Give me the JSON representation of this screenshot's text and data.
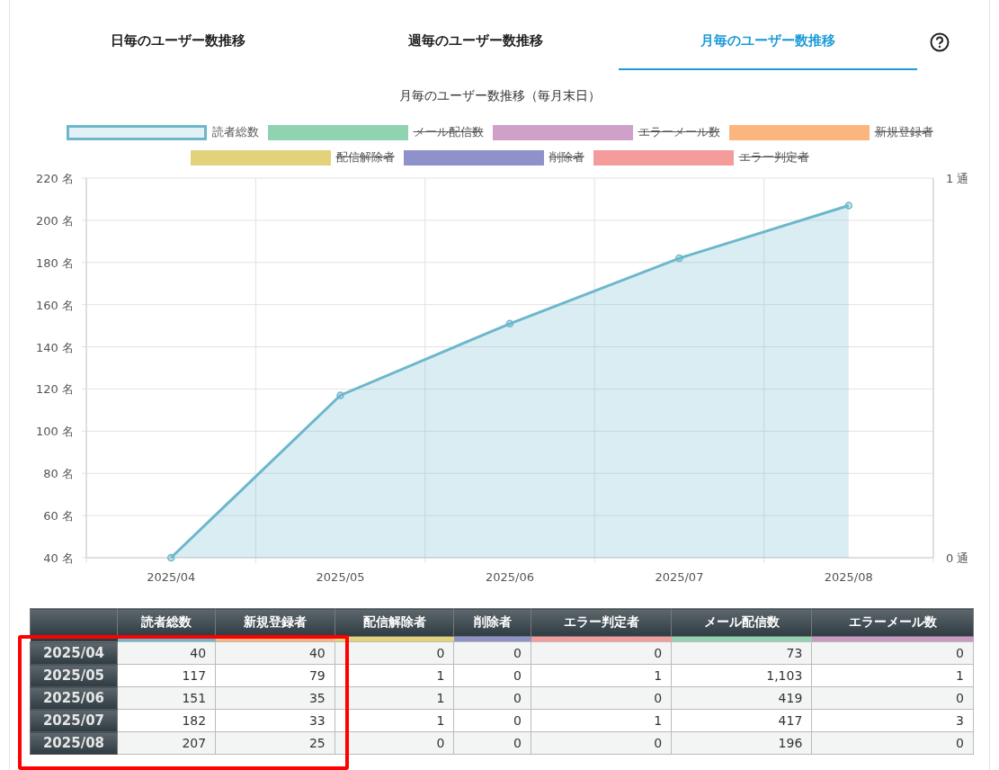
{
  "tabs": [
    {
      "label": "日毎のユーザー数推移",
      "selected": false
    },
    {
      "label": "週毎のユーザー数推移",
      "selected": false
    },
    {
      "label": "月毎のユーザー数推移",
      "selected": true
    }
  ],
  "chart": {
    "title": "月毎のユーザー数推移（毎月末日）",
    "legend": [
      {
        "label": "読者総数",
        "color": "#6cb7cb",
        "hidden": false
      },
      {
        "label": "メール配信数",
        "color": "#8fd3b0",
        "hidden": true
      },
      {
        "label": "エラーメール数",
        "color": "#cfa0c8",
        "hidden": true
      },
      {
        "label": "新規登録者",
        "color": "#fcb57e",
        "hidden": true
      },
      {
        "label": "配信解除者",
        "color": "#e2d37a",
        "hidden": true
      },
      {
        "label": "削除者",
        "color": "#8f92c9",
        "hidden": true
      },
      {
        "label": "エラー判定者",
        "color": "#f49c9c",
        "hidden": true
      }
    ],
    "right_axis_labels": [
      "1 通",
      "0 通"
    ],
    "chart_data": {
      "type": "area",
      "categories": [
        "2025/04",
        "2025/05",
        "2025/06",
        "2025/07",
        "2025/08"
      ],
      "series": [
        {
          "color": "#6cb7cb",
          "values": [
            40,
            117,
            151,
            182,
            207
          ]
        }
      ],
      "grid": true,
      "ylim": [
        40,
        220
      ],
      "yticks": [
        {
          "value": 40,
          "label": "40 名"
        },
        {
          "value": 60,
          "label": "60 名"
        },
        {
          "value": 80,
          "label": "80 名"
        },
        {
          "value": 100,
          "label": "100 名"
        },
        {
          "value": 120,
          "label": "120 名"
        },
        {
          "value": 140,
          "label": "140 名"
        },
        {
          "value": 160,
          "label": "160 名"
        },
        {
          "value": 180,
          "label": "180 名"
        },
        {
          "value": 200,
          "label": "200 名"
        },
        {
          "value": 220,
          "label": "220 名"
        }
      ]
    }
  },
  "table": {
    "highlight_frame": true,
    "columns": [
      {
        "label": "読者総数",
        "color": "#6cb7cb"
      },
      {
        "label": "新規登録者",
        "color": "#fcb57e"
      },
      {
        "label": "配信解除者",
        "color": "#e2d37a"
      },
      {
        "label": "削除者",
        "color": "#8f92c9"
      },
      {
        "label": "エラー判定者",
        "color": "#f49c9c"
      },
      {
        "label": "メール配信数",
        "color": "#8fd3b0"
      },
      {
        "label": "エラーメール数",
        "color": "#c999c2"
      }
    ],
    "rows": [
      {
        "label": "2025/04",
        "cells": [
          "40",
          "40",
          "0",
          "0",
          "0",
          "73",
          "0"
        ]
      },
      {
        "label": "2025/05",
        "cells": [
          "117",
          "79",
          "1",
          "0",
          "1",
          "1,103",
          "1"
        ]
      },
      {
        "label": "2025/06",
        "cells": [
          "151",
          "35",
          "1",
          "0",
          "0",
          "419",
          "0"
        ]
      },
      {
        "label": "2025/07",
        "cells": [
          "182",
          "33",
          "1",
          "0",
          "1",
          "417",
          "3"
        ]
      },
      {
        "label": "2025/08",
        "cells": [
          "207",
          "25",
          "0",
          "0",
          "0",
          "196",
          "0"
        ]
      }
    ]
  }
}
